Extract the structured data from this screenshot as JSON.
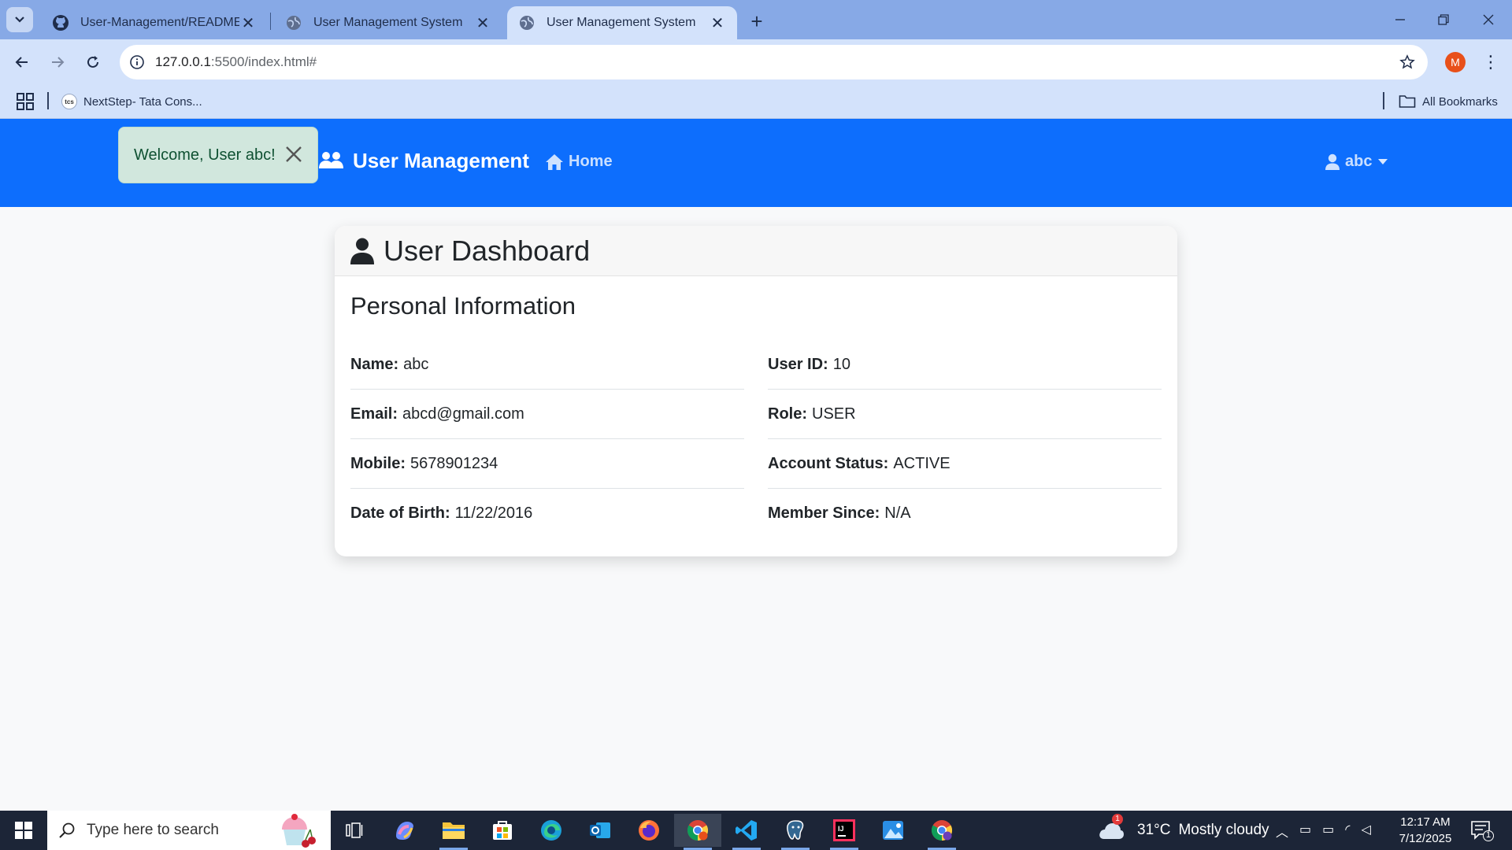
{
  "browser": {
    "tabs": [
      {
        "title": "User-Management/README.md",
        "icon": "github-icon"
      },
      {
        "title": "User Management System",
        "icon": "globe-icon"
      },
      {
        "title": "User Management System",
        "icon": "globe-icon",
        "active": true
      }
    ],
    "url_host": "127.0.0.1",
    "url_path": ":5500/index.html#",
    "profile_initial": "M",
    "bookmarks": [
      {
        "label": "NextStep- Tata Cons...",
        "icon_text": "tcs"
      }
    ],
    "all_bookmarks_label": "All Bookmarks"
  },
  "app": {
    "brand": "User Management",
    "nav_home": "Home",
    "user_menu": "abc",
    "accent_color": "#0d6efd"
  },
  "toast": {
    "message": "Welcome, User abc!"
  },
  "dashboard": {
    "title": "User Dashboard",
    "section_title": "Personal Information",
    "left": [
      {
        "label": "Name:",
        "value": "abc"
      },
      {
        "label": "Email:",
        "value": "abcd@gmail.com"
      },
      {
        "label": "Mobile:",
        "value": "5678901234"
      },
      {
        "label": "Date of Birth:",
        "value": "11/22/2016"
      }
    ],
    "right": [
      {
        "label": "User ID:",
        "value": "10"
      },
      {
        "label": "Role:",
        "value": "USER"
      },
      {
        "label": "Account Status:",
        "value": "ACTIVE"
      },
      {
        "label": "Member Since:",
        "value": "N/A"
      }
    ]
  },
  "taskbar": {
    "search_placeholder": "Type here to search",
    "weather_temp": "31°C",
    "weather_condition": "Mostly cloudy",
    "weather_badge": "1",
    "time": "12:17 AM",
    "date": "7/12/2025",
    "notification_count": "1"
  }
}
